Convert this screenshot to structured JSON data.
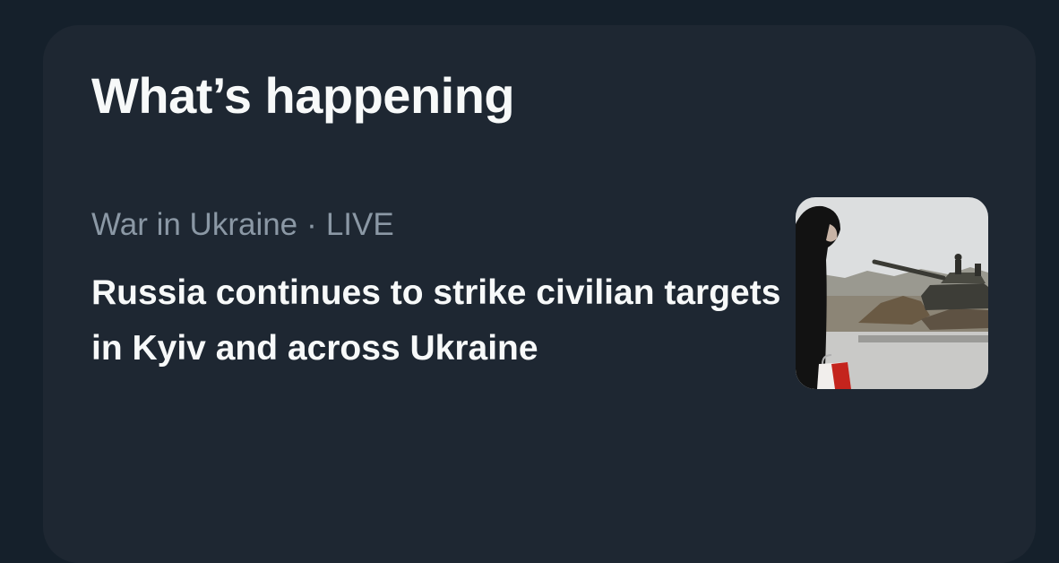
{
  "section": {
    "title": "What’s happening"
  },
  "trend": {
    "category": "War in Ukraine",
    "separator": "·",
    "status": "LIVE",
    "headline": "Russia continues to strike civilian targets in Kyiv and across Ukraine",
    "thumbnail_icon": "news-photo-thumbnail"
  },
  "colors": {
    "page_background": "#15202b",
    "panel_background": "#1e2732",
    "primary_text": "#f7f9f9",
    "secondary_text": "#8b98a5"
  }
}
